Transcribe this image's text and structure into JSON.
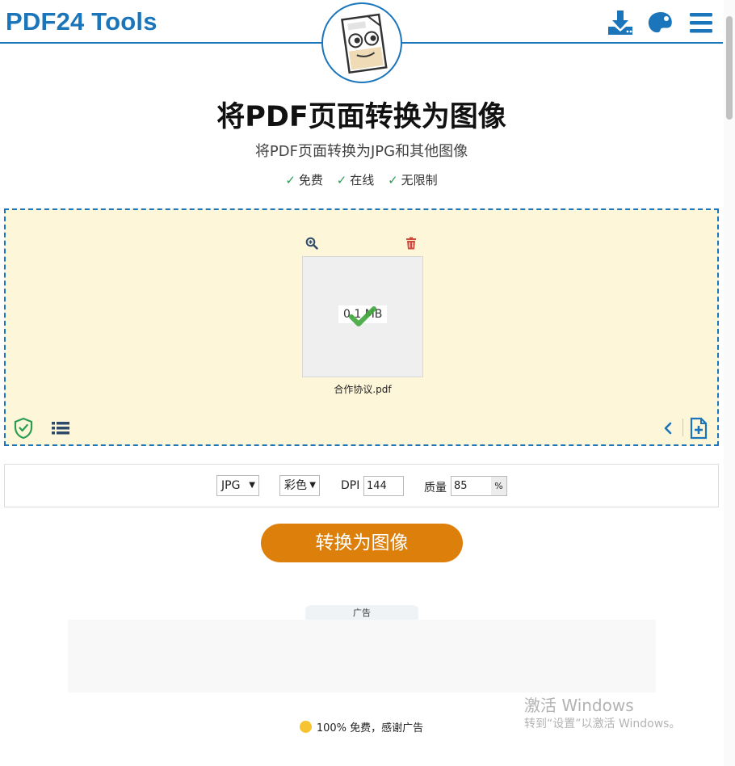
{
  "header": {
    "logo": "PDF24 Tools",
    "icons": [
      "download-icon",
      "palette-icon",
      "menu-icon"
    ]
  },
  "hero": {
    "title": "将PDF页面转换为图像",
    "subtitle": "将PDF页面转换为JPG和其他图像",
    "features": [
      "免费",
      "在线",
      "无限制"
    ],
    "check_mark": "✓"
  },
  "dropzone": {
    "file": {
      "name": "合作协议.pdf",
      "size": "0.1 MB"
    },
    "icons": [
      "zoom-in-icon",
      "trash-icon",
      "shield-check-icon",
      "list-icon",
      "chevron-left-icon",
      "add-file-icon"
    ]
  },
  "options": {
    "format": "JPG",
    "color": "彩色",
    "dpi_label": "DPI",
    "dpi_value": "144",
    "quality_label": "质量",
    "quality_value": "85",
    "quality_unit": "%"
  },
  "convert_button": "转换为图像",
  "ad": {
    "label": "广告",
    "thanks": "100% 免费，感谢广告"
  },
  "watermark": {
    "title": "激活 Windows",
    "subtitle": "转到“设置”以激活 Windows。"
  },
  "colors": {
    "brand": "#1b75bb",
    "accent": "#dc800b",
    "dropzone_bg": "#fef6d8",
    "check": "#2a9d55",
    "delete": "#d04a3a"
  }
}
